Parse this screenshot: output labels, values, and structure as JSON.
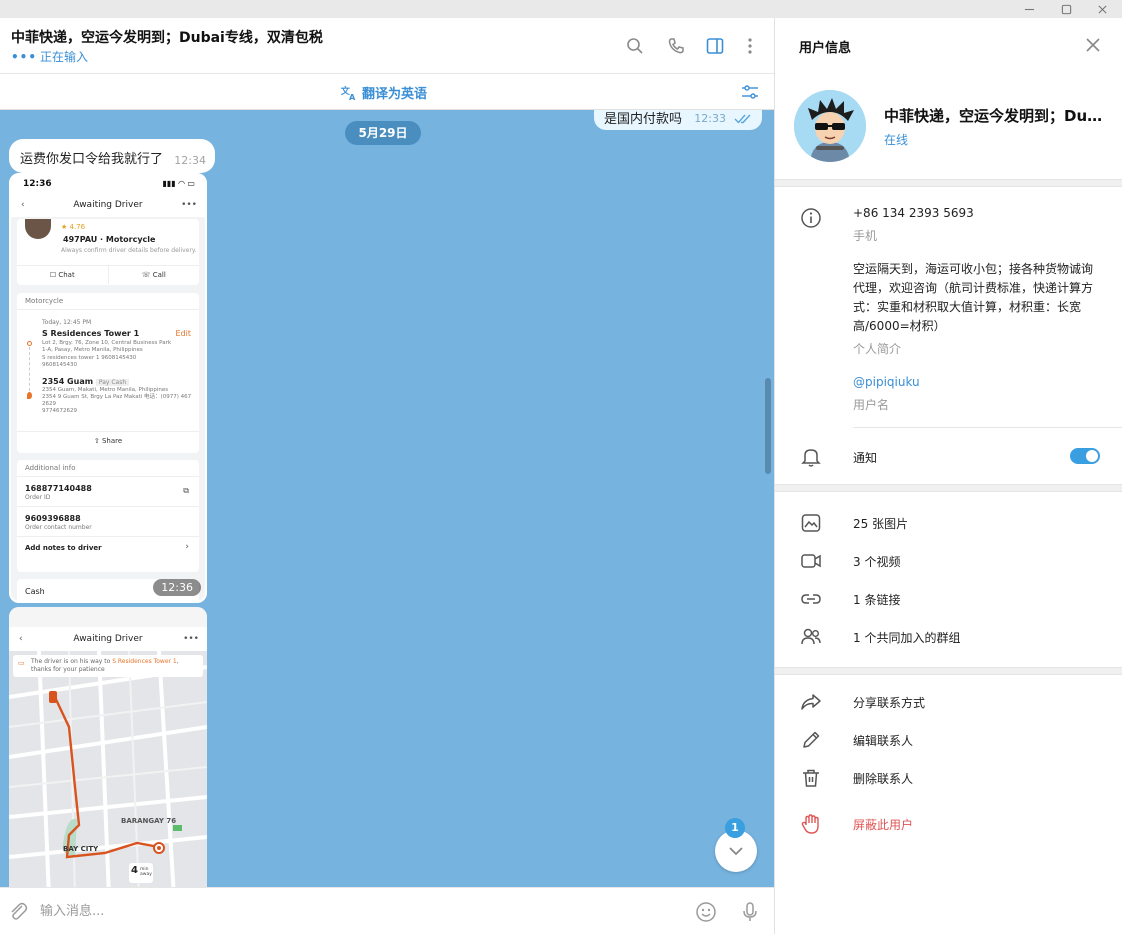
{
  "window": {
    "controls": [
      "minimize-icon",
      "maximize-icon",
      "close-icon"
    ]
  },
  "chat": {
    "title": "中菲快递，空运今发明到；Dubai专线，双清包税",
    "status_dots": "•••",
    "status": "正在输入",
    "translate_label": "翻译为英语",
    "header_icons": [
      "search-icon",
      "phone-icon",
      "sidebar-toggle-icon",
      "more-vertical-icon"
    ],
    "outgoing_message": {
      "text": "是国内付款吗",
      "time": "12:33"
    },
    "date_divider": "5月29日",
    "incoming_message": {
      "text": "运费你发口令给我就行了",
      "time": "12:34"
    },
    "image_message_1": {
      "time": "12:36",
      "phone_time": "12:36",
      "nav_title": "Awaiting Driver",
      "rating": "★ 4.76",
      "plate": "497PAU · Motorcycle",
      "driver_note": "Always confirm driver details before delivery.",
      "chat_label": "Chat",
      "call_label": "Call",
      "section_motorcycle": "Motorcycle",
      "pickup_time": "Today, 12:45 PM",
      "pickup_name": "S Residences Tower 1",
      "edit_label": "Edit",
      "pickup_addr": "Lot 2, Brgy. 76, Zone 10, Central Business Park 1-A, Pasay, Metro Manila, Philippines",
      "pickup_contact": "S residences tower 1  9608145430",
      "pickup_phone": "9608145430",
      "dropoff_name": "2354 Guam",
      "pay_cash": "Pay Cash",
      "dropoff_addr": "2354 Guam, Makati, Metro Manila, Philippines",
      "dropoff_addr2": "2354 9 Guam St, Brgy La Paz Makati 电话：(0977) 467 2629",
      "dropoff_phone": "9774672629",
      "share_label": "Share",
      "additional_info": "Additional info",
      "order_id": "168877140488",
      "order_id_label": "Order ID",
      "contact_number": "9609396888",
      "contact_label": "Order contact number",
      "add_notes": "Add notes to driver",
      "cash_label": "Cash"
    },
    "image_message_2": {
      "nav_title": "Awaiting Driver",
      "banner_prefix": "The driver is on his way to ",
      "banner_place": "S Residences Tower 1",
      "banner_suffix": ", thanks for your patience",
      "map_barangay": "BARANGAY 76",
      "map_bay_city": "BAY CITY",
      "map_minutes": "4",
      "map_minutes_label": "min away"
    },
    "unread_badge": "1",
    "composer_placeholder": "输入消息..."
  },
  "panel": {
    "title": "用户信息",
    "name": "中菲快递，空运今发明到；Dubai专线，双清包税",
    "status": "在线",
    "phone": "+86 134 2393 5693",
    "phone_label": "手机",
    "bio": "空运隔天到，海运可收小包；接各种货物诚询代理，欢迎咨询（航司计费标准，快递计算方式：实重和材积取大值计算，材积重：长宽高/6000=材积）",
    "bio_label": "个人简介",
    "username": "@pipiqiuku",
    "username_label": "用户名",
    "notifications_label": "通知",
    "notifications_on": true,
    "media": [
      {
        "icon": "photo-icon",
        "label": "25 张图片"
      },
      {
        "icon": "video-icon",
        "label": "3 个视频"
      },
      {
        "icon": "link-icon",
        "label": "1 条链接"
      },
      {
        "icon": "group-icon",
        "label": "1 个共同加入的群组"
      }
    ],
    "actions": [
      {
        "icon": "share-icon",
        "label": "分享联系方式"
      },
      {
        "icon": "edit-icon",
        "label": "编辑联系人"
      },
      {
        "icon": "trash-icon",
        "label": "删除联系人"
      },
      {
        "icon": "block-hand-icon",
        "label": "屏蔽此用户"
      }
    ],
    "accent_color": "#3a8fd6",
    "danger_color": "#e05555"
  }
}
